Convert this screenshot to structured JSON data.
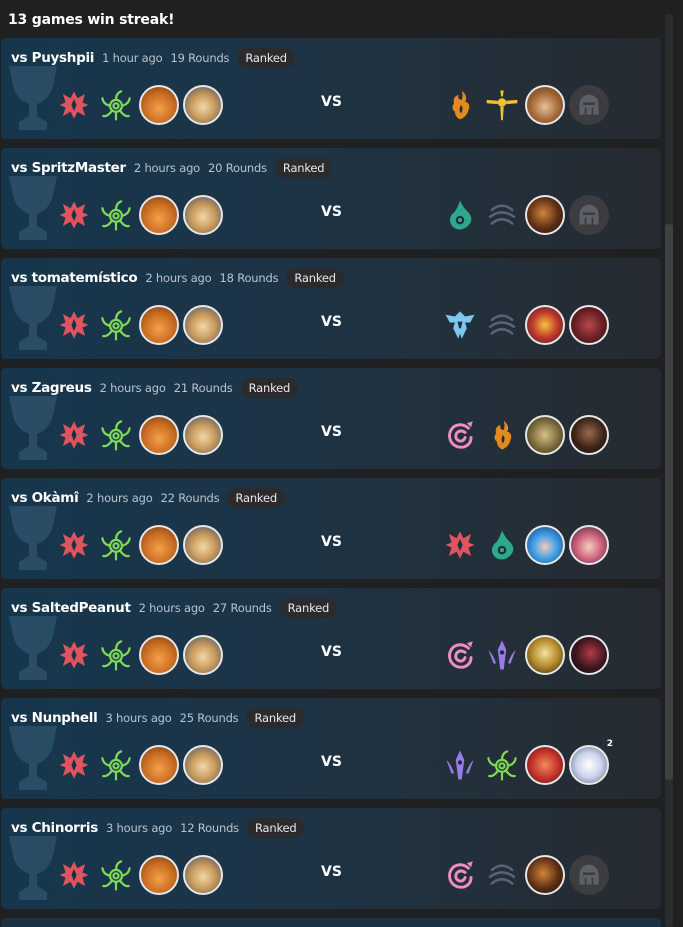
{
  "page": {
    "title": "13 games win streak!"
  },
  "vs_label": "VS",
  "matches": [
    {
      "opponent": "vs Puyshpii",
      "time": "1 hour ago",
      "rounds": "19 Rounds",
      "mode": "Ranked",
      "left": [
        "crimson-emblem",
        "vine-emblem",
        "avatar-orange",
        "avatar-blond"
      ],
      "right": [
        "flame-emblem-orange",
        "sun-emblem-gold",
        "avatar-brown-hair",
        "helmet-placeholder"
      ]
    },
    {
      "opponent": "vs SpritzMaster",
      "time": "2 hours ago",
      "rounds": "20 Rounds",
      "mode": "Ranked",
      "left": [
        "crimson-emblem",
        "vine-emblem",
        "avatar-orange",
        "avatar-blond"
      ],
      "right": [
        "teal-drop-emblem",
        "gray-swirl-emblem",
        "avatar-dark-warrior",
        "helmet-placeholder"
      ]
    },
    {
      "opponent": "vs tomatemístico",
      "time": "2 hours ago",
      "rounds": "18 Rounds",
      "mode": "Ranked",
      "left": [
        "crimson-emblem",
        "vine-emblem",
        "avatar-orange",
        "avatar-blond"
      ],
      "right": [
        "ice-crest-emblem",
        "gray-swirl-emblem",
        "avatar-red-mask",
        "avatar-crimson-beast"
      ]
    },
    {
      "opponent": "vs Zagreus",
      "time": "2 hours ago",
      "rounds": "21 Rounds",
      "mode": "Ranked",
      "left": [
        "crimson-emblem",
        "vine-emblem",
        "avatar-orange",
        "avatar-blond"
      ],
      "right": [
        "pink-spiral-emblem",
        "flame-emblem-orange",
        "avatar-olive-brute",
        "avatar-dark-hood"
      ]
    },
    {
      "opponent": "vs Okàmî",
      "time": "2 hours ago",
      "rounds": "22 Rounds",
      "mode": "Ranked",
      "left": [
        "crimson-emblem",
        "vine-emblem",
        "avatar-orange",
        "avatar-blond"
      ],
      "right": [
        "crimson-emblem",
        "teal-drop-emblem",
        "avatar-blue-hair",
        "avatar-pink-hair"
      ]
    },
    {
      "opponent": "vs SaltedPeanut",
      "time": "2 hours ago",
      "rounds": "27 Rounds",
      "mode": "Ranked",
      "left": [
        "crimson-emblem",
        "vine-emblem",
        "avatar-orange",
        "avatar-blond"
      ],
      "right": [
        "pink-spiral-emblem",
        "violet-shard-emblem",
        "avatar-gold-armor",
        "avatar-shadow-red"
      ]
    },
    {
      "opponent": "vs Nunphell",
      "time": "3 hours ago",
      "rounds": "25 Rounds",
      "mode": "Ranked",
      "left": [
        "crimson-emblem",
        "vine-emblem",
        "avatar-orange",
        "avatar-blond"
      ],
      "right": [
        "violet-shard-emblem",
        "vine-emblem",
        "avatar-red-fur",
        "avatar-white-cat"
      ],
      "star_badge": "2"
    },
    {
      "opponent": "vs Chinorris",
      "time": "3 hours ago",
      "rounds": "12 Rounds",
      "mode": "Ranked",
      "left": [
        "crimson-emblem",
        "vine-emblem",
        "avatar-orange",
        "avatar-blond"
      ],
      "right": [
        "pink-spiral-emblem",
        "gray-swirl-emblem",
        "avatar-dark-warrior",
        "helmet-placeholder"
      ]
    }
  ],
  "colors": {
    "crimson": "#e0535f",
    "vine": "#7ed957",
    "flame": "#e38a1e",
    "sun": "#f2c233",
    "teal": "#2ea88a",
    "gray_swirl": "#566275",
    "ice": "#7ec8f0",
    "pink": "#f08ec0",
    "violet": "#9b7be8"
  }
}
